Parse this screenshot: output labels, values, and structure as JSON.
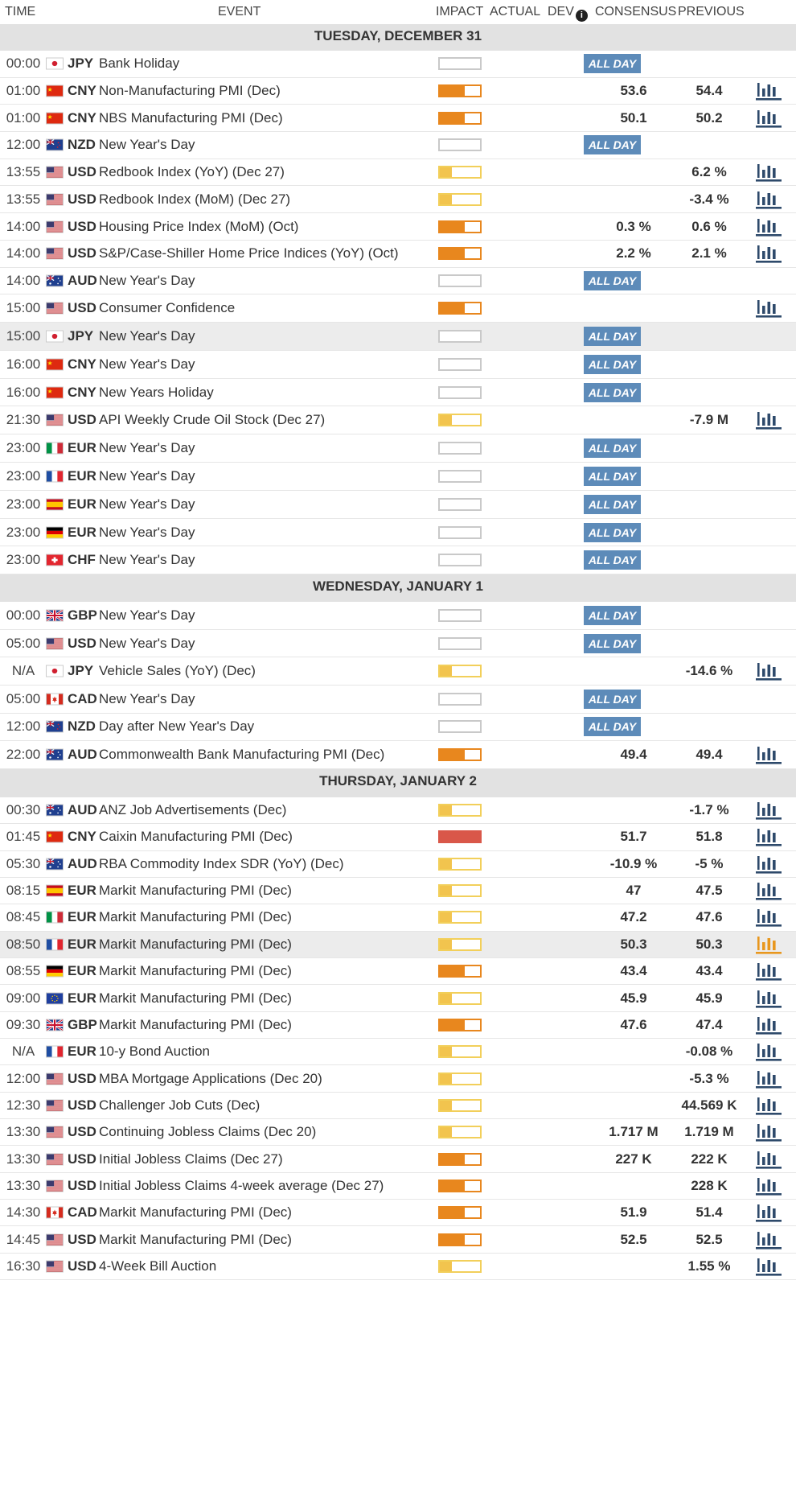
{
  "header": {
    "time": "TIME",
    "event": "EVENT",
    "impact": "IMPACT",
    "actual": "ACTUAL",
    "dev": "DEV",
    "consensus": "CONSENSUS",
    "previous": "PREVIOUS"
  },
  "colors": {
    "impact_low": "#f2c44e",
    "impact_medium": "#e8871e",
    "impact_high": "#d95749",
    "all_day_badge": "#5d8bb9",
    "chart_icon": "#2e4a6b",
    "chart_icon_active": "#e8971e",
    "day_header_bg": "#e2e2e2"
  },
  "days": [
    {
      "label": "TUESDAY, DECEMBER 31",
      "events": [
        {
          "time": "00:00",
          "flag": "jp",
          "currency": "JPY",
          "name": "Bank Holiday",
          "impact": "none",
          "all_day": "ALL DAY"
        },
        {
          "time": "01:00",
          "flag": "cn",
          "currency": "CNY",
          "name": "Non-Manufacturing PMI (Dec)",
          "impact": "medium",
          "consensus": "53.6",
          "previous": "54.4",
          "chart": true
        },
        {
          "time": "01:00",
          "flag": "cn",
          "currency": "CNY",
          "name": "NBS Manufacturing PMI (Dec)",
          "impact": "medium",
          "consensus": "50.1",
          "previous": "50.2",
          "chart": true
        },
        {
          "time": "12:00",
          "flag": "nz",
          "currency": "NZD",
          "name": "New Year's Day",
          "impact": "none",
          "all_day": "ALL DAY"
        },
        {
          "time": "13:55",
          "flag": "us",
          "currency": "USD",
          "name": "Redbook Index (YoY) (Dec 27)",
          "impact": "low",
          "previous": "6.2 %",
          "chart": true
        },
        {
          "time": "13:55",
          "flag": "us",
          "currency": "USD",
          "name": "Redbook Index (MoM) (Dec 27)",
          "impact": "low",
          "previous": "-3.4 %",
          "chart": true
        },
        {
          "time": "14:00",
          "flag": "us",
          "currency": "USD",
          "name": "Housing Price Index (MoM) (Oct)",
          "impact": "medium",
          "consensus": "0.3 %",
          "previous": "0.6 %",
          "chart": true
        },
        {
          "time": "14:00",
          "flag": "us",
          "currency": "USD",
          "name": "S&P/Case-Shiller Home Price Indices (YoY) (Oct)",
          "impact": "medium",
          "consensus": "2.2 %",
          "previous": "2.1 %",
          "chart": true
        },
        {
          "time": "14:00",
          "flag": "au",
          "currency": "AUD",
          "name": "New Year's Day",
          "impact": "none",
          "all_day": "ALL DAY"
        },
        {
          "time": "15:00",
          "flag": "us",
          "currency": "USD",
          "name": "Consumer Confidence",
          "impact": "medium",
          "chart": true
        },
        {
          "time": "15:00",
          "flag": "jp",
          "currency": "JPY",
          "name": "New Year's Day",
          "impact": "none",
          "all_day": "ALL DAY",
          "highlight": true
        },
        {
          "time": "16:00",
          "flag": "cn",
          "currency": "CNY",
          "name": "New Year's Day",
          "impact": "none",
          "all_day": "ALL DAY"
        },
        {
          "time": "16:00",
          "flag": "cn",
          "currency": "CNY",
          "name": "New Years Holiday",
          "impact": "none",
          "all_day": "ALL DAY"
        },
        {
          "time": "21:30",
          "flag": "us",
          "currency": "USD",
          "name": "API Weekly Crude Oil Stock (Dec 27)",
          "impact": "low",
          "previous": "-7.9 M",
          "chart": true
        },
        {
          "time": "23:00",
          "flag": "it",
          "currency": "EUR",
          "name": "New Year's Day",
          "impact": "none",
          "all_day": "ALL DAY"
        },
        {
          "time": "23:00",
          "flag": "fr",
          "currency": "EUR",
          "name": "New Year's Day",
          "impact": "none",
          "all_day": "ALL DAY"
        },
        {
          "time": "23:00",
          "flag": "es",
          "currency": "EUR",
          "name": "New Year's Day",
          "impact": "none",
          "all_day": "ALL DAY"
        },
        {
          "time": "23:00",
          "flag": "de",
          "currency": "EUR",
          "name": "New Year's Day",
          "impact": "none",
          "all_day": "ALL DAY"
        },
        {
          "time": "23:00",
          "flag": "ch",
          "currency": "CHF",
          "name": "New Year's Day",
          "impact": "none",
          "all_day": "ALL DAY"
        }
      ]
    },
    {
      "label": "WEDNESDAY, JANUARY 1",
      "events": [
        {
          "time": "00:00",
          "flag": "gb",
          "currency": "GBP",
          "name": "New Year's Day",
          "impact": "none",
          "all_day": "ALL DAY"
        },
        {
          "time": "05:00",
          "flag": "us",
          "currency": "USD",
          "name": "New Year's Day",
          "impact": "none",
          "all_day": "ALL DAY"
        },
        {
          "time": "N/A",
          "flag": "jp",
          "currency": "JPY",
          "name": "Vehicle Sales (YoY) (Dec)",
          "impact": "low",
          "previous": "-14.6 %",
          "chart": true
        },
        {
          "time": "05:00",
          "flag": "ca",
          "currency": "CAD",
          "name": "New Year's Day",
          "impact": "none",
          "all_day": "ALL DAY"
        },
        {
          "time": "12:00",
          "flag": "nz",
          "currency": "NZD",
          "name": "Day after New Year's Day",
          "impact": "none",
          "all_day": "ALL DAY"
        },
        {
          "time": "22:00",
          "flag": "au",
          "currency": "AUD",
          "name": "Commonwealth Bank Manufacturing PMI (Dec)",
          "impact": "medium",
          "consensus": "49.4",
          "previous": "49.4",
          "chart": true
        }
      ]
    },
    {
      "label": "THURSDAY, JANUARY 2",
      "events": [
        {
          "time": "00:30",
          "flag": "au",
          "currency": "AUD",
          "name": "ANZ Job Advertisements (Dec)",
          "impact": "low",
          "previous": "-1.7 %",
          "chart": true
        },
        {
          "time": "01:45",
          "flag": "cn",
          "currency": "CNY",
          "name": "Caixin Manufacturing PMI (Dec)",
          "impact": "high",
          "consensus": "51.7",
          "previous": "51.8",
          "chart": true
        },
        {
          "time": "05:30",
          "flag": "au",
          "currency": "AUD",
          "name": "RBA Commodity Index SDR (YoY) (Dec)",
          "impact": "low",
          "consensus": "-10.9 %",
          "previous": "-5 %",
          "chart": true
        },
        {
          "time": "08:15",
          "flag": "es",
          "currency": "EUR",
          "name": "Markit Manufacturing PMI (Dec)",
          "impact": "low",
          "consensus": "47",
          "previous": "47.5",
          "chart": true
        },
        {
          "time": "08:45",
          "flag": "it",
          "currency": "EUR",
          "name": "Markit Manufacturing PMI (Dec)",
          "impact": "low",
          "consensus": "47.2",
          "previous": "47.6",
          "chart": true
        },
        {
          "time": "08:50",
          "flag": "fr",
          "currency": "EUR",
          "name": "Markit Manufacturing PMI (Dec)",
          "impact": "low",
          "consensus": "50.3",
          "previous": "50.3",
          "chart": true,
          "highlight": true,
          "chart_active": true
        },
        {
          "time": "08:55",
          "flag": "de",
          "currency": "EUR",
          "name": "Markit Manufacturing PMI (Dec)",
          "impact": "medium",
          "consensus": "43.4",
          "previous": "43.4",
          "chart": true
        },
        {
          "time": "09:00",
          "flag": "eu",
          "currency": "EUR",
          "name": "Markit Manufacturing PMI (Dec)",
          "impact": "low",
          "consensus": "45.9",
          "previous": "45.9",
          "chart": true
        },
        {
          "time": "09:30",
          "flag": "gb",
          "currency": "GBP",
          "name": "Markit Manufacturing PMI (Dec)",
          "impact": "medium",
          "consensus": "47.6",
          "previous": "47.4",
          "chart": true
        },
        {
          "time": "N/A",
          "flag": "fr",
          "currency": "EUR",
          "name": "10-y Bond Auction",
          "impact": "low",
          "previous": "-0.08 %",
          "chart": true
        },
        {
          "time": "12:00",
          "flag": "us",
          "currency": "USD",
          "name": "MBA Mortgage Applications (Dec 20)",
          "impact": "low",
          "previous": "-5.3 %",
          "chart": true
        },
        {
          "time": "12:30",
          "flag": "us",
          "currency": "USD",
          "name": "Challenger Job Cuts (Dec)",
          "impact": "low",
          "previous": "44.569 K",
          "chart": true
        },
        {
          "time": "13:30",
          "flag": "us",
          "currency": "USD",
          "name": "Continuing Jobless Claims (Dec 20)",
          "impact": "low",
          "consensus": "1.717 M",
          "previous": "1.719 M",
          "chart": true
        },
        {
          "time": "13:30",
          "flag": "us",
          "currency": "USD",
          "name": "Initial Jobless Claims (Dec 27)",
          "impact": "medium",
          "consensus": "227 K",
          "previous": "222 K",
          "chart": true
        },
        {
          "time": "13:30",
          "flag": "us",
          "currency": "USD",
          "name": "Initial Jobless Claims 4-week average (Dec 27)",
          "impact": "medium",
          "previous": "228 K",
          "chart": true
        },
        {
          "time": "14:30",
          "flag": "ca",
          "currency": "CAD",
          "name": "Markit Manufacturing PMI (Dec)",
          "impact": "medium",
          "consensus": "51.9",
          "previous": "51.4",
          "chart": true
        },
        {
          "time": "14:45",
          "flag": "us",
          "currency": "USD",
          "name": "Markit Manufacturing PMI (Dec)",
          "impact": "medium",
          "consensus": "52.5",
          "previous": "52.5",
          "chart": true
        },
        {
          "time": "16:30",
          "flag": "us",
          "currency": "USD",
          "name": "4-Week Bill Auction",
          "impact": "low",
          "previous": "1.55 %",
          "chart": true
        }
      ]
    }
  ]
}
